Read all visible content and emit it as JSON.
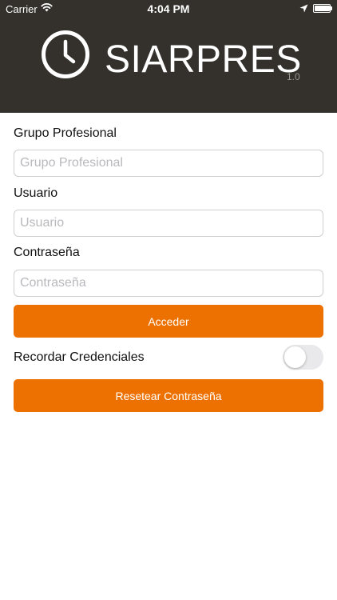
{
  "status_bar": {
    "carrier": "Carrier",
    "time": "4:04 PM",
    "battery_level": 0.95
  },
  "header": {
    "title": "SIARPRES",
    "version": "1.0",
    "logo_icon": "clock-icon"
  },
  "form": {
    "grupo": {
      "label": "Grupo Profesional",
      "placeholder": "Grupo Profesional",
      "value": ""
    },
    "usuario": {
      "label": "Usuario",
      "placeholder": "Usuario",
      "value": ""
    },
    "password": {
      "label": "Contraseña",
      "placeholder": "Contraseña",
      "value": ""
    },
    "login_button": "Acceder",
    "remember": {
      "label": "Recordar Credenciales",
      "checked": false
    },
    "reset_button": "Resetear Contraseña"
  },
  "colors": {
    "header_bg": "#34302c",
    "accent": "#ed7100"
  }
}
